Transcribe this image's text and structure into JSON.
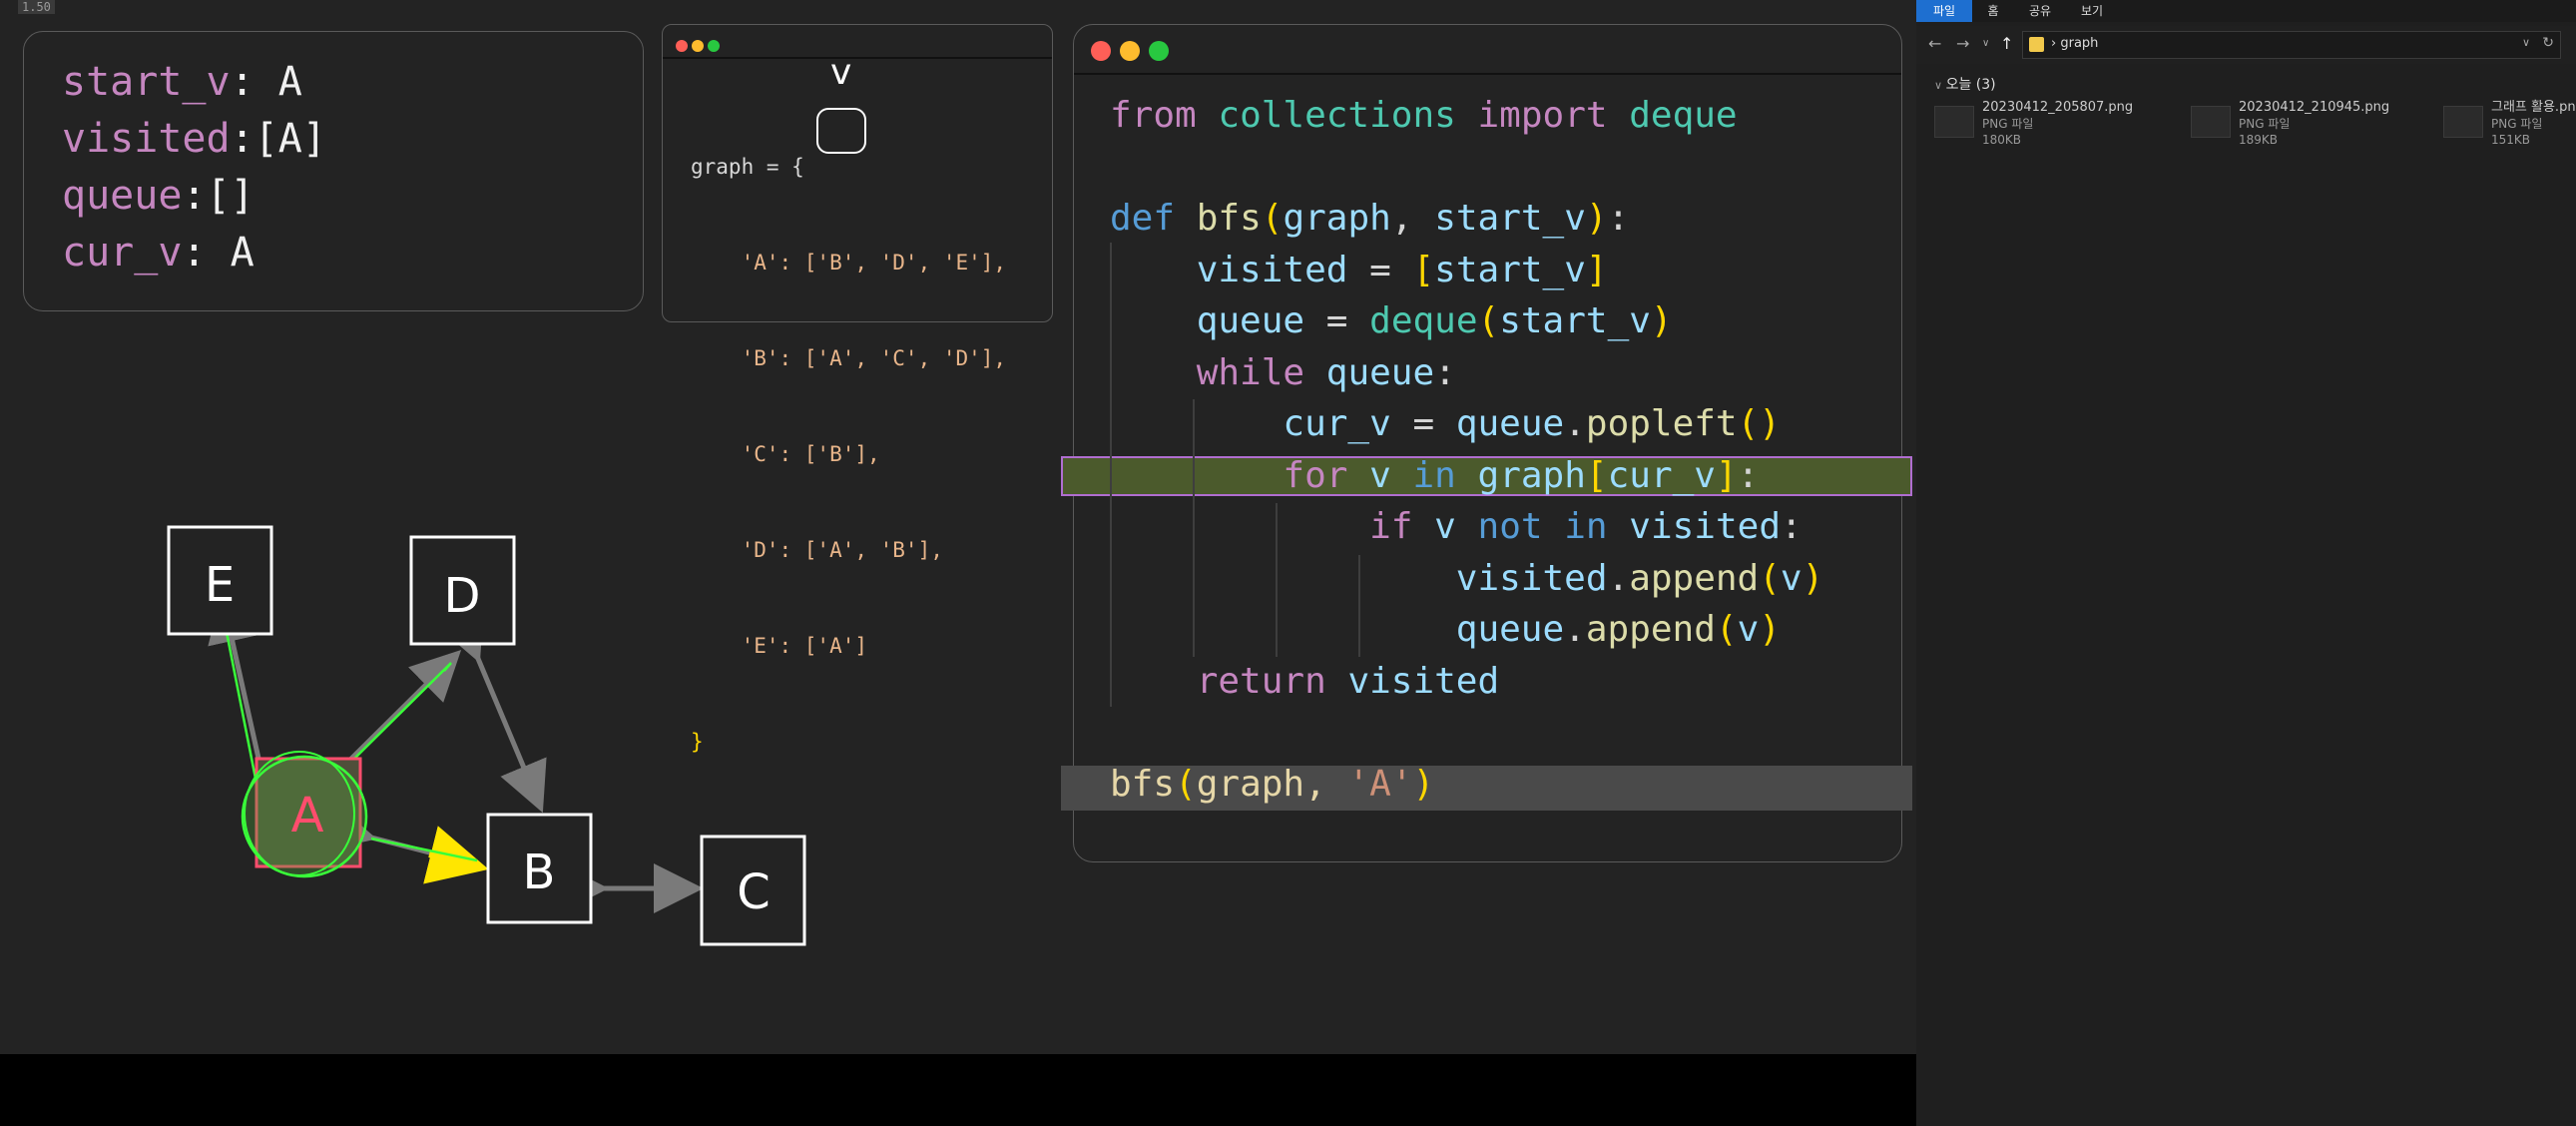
{
  "corner_label": "1.50",
  "variables": {
    "start_v_key": "start_v",
    "start_v_sep": ": ",
    "start_v_val": "A",
    "visited_key": "visited",
    "visited_sep": ":",
    "visited_val": "[A]",
    "queue_key": "queue",
    "queue_sep": ":",
    "queue_val": "[]",
    "cur_v_key": "cur_v",
    "cur_v_sep": ": ",
    "cur_v_val": "A"
  },
  "graph_dict": {
    "lines": [
      "graph = {",
      "    'A': ['B', 'D', 'E'],",
      "    'B': ['A', 'C', 'D'],",
      "    'C': ['B'],",
      "    'D': ['A', 'B'],",
      "    'E': ['A']",
      "}"
    ],
    "annotation": "v"
  },
  "code": {
    "lines": [
      "from collections import deque",
      "",
      "def bfs(graph, start_v):",
      "    visited = [start_v]",
      "    queue = deque(start_v)",
      "    while queue:",
      "        cur_v = queue.popleft()",
      "        for v in graph[cur_v]:",
      "            if v not in visited:",
      "                visited.append(v)",
      "                queue.append(v)",
      "    return visited",
      "",
      "bfs(graph, 'A')"
    ]
  },
  "diagram": {
    "nodes": [
      "E",
      "D",
      "A",
      "B",
      "C"
    ]
  },
  "explorer": {
    "tabs": [
      "파일",
      "홈",
      "공유",
      "보기"
    ],
    "path": "graph",
    "group": "오늘 (3)",
    "files": [
      {
        "name": "20230412_205807.png",
        "type": "PNG 파일",
        "size": "180KB"
      },
      {
        "name": "20230412_210945.png",
        "type": "PNG 파일",
        "size": "189KB"
      },
      {
        "name": "그래프 활용.png",
        "type": "PNG 파일",
        "size": "151KB"
      }
    ]
  },
  "colors": {
    "window_close": "#ff5f57",
    "window_min": "#febc2e",
    "window_max": "#28c840",
    "highlight_border": "#b06ed0",
    "annotation_green": "#39ff39",
    "node_a_red": "#ff4d6d"
  }
}
